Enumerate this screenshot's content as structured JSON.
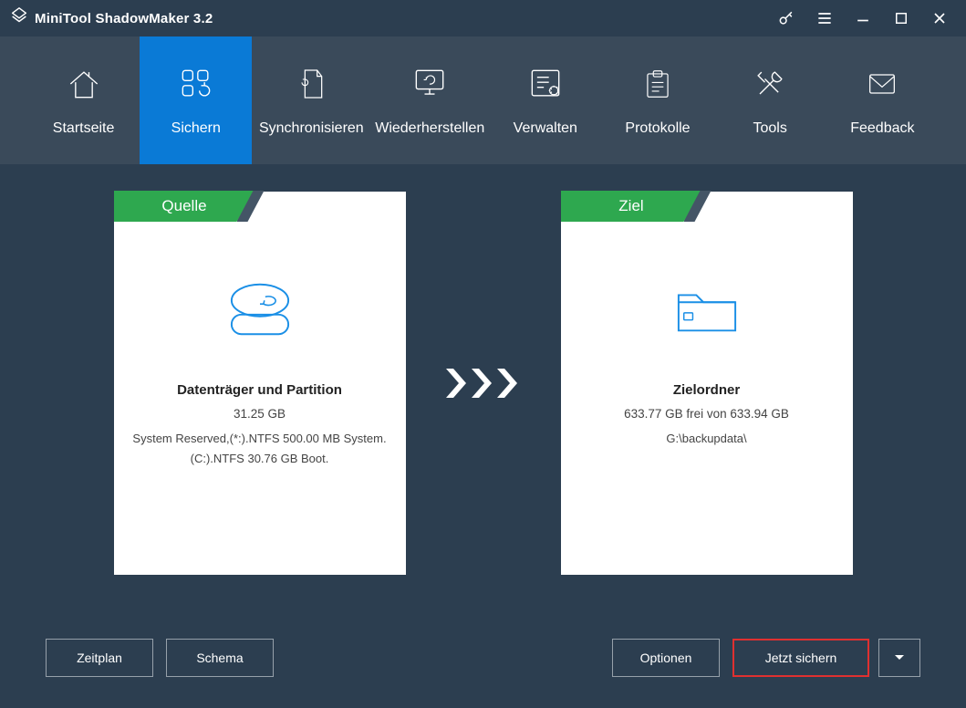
{
  "app": {
    "title": "MiniTool ShadowMaker 3.2"
  },
  "nav": {
    "home": "Startseite",
    "backup": "Sichern",
    "sync": "Synchronisieren",
    "restore": "Wiederherstellen",
    "manage": "Verwalten",
    "logs": "Protokolle",
    "tools": "Tools",
    "feedback": "Feedback"
  },
  "source": {
    "tab": "Quelle",
    "title": "Datenträger und Partition",
    "size": "31.25 GB",
    "line1": "System Reserved,(*:).NTFS 500.00 MB System.",
    "line2": "(C:).NTFS 30.76 GB Boot."
  },
  "dest": {
    "tab": "Ziel",
    "title": "Zielordner",
    "free": "633.77 GB frei von 633.94 GB",
    "path": "G:\\backupdata\\"
  },
  "buttons": {
    "schedule": "Zeitplan",
    "scheme": "Schema",
    "options": "Optionen",
    "backup_now": "Jetzt sichern"
  }
}
